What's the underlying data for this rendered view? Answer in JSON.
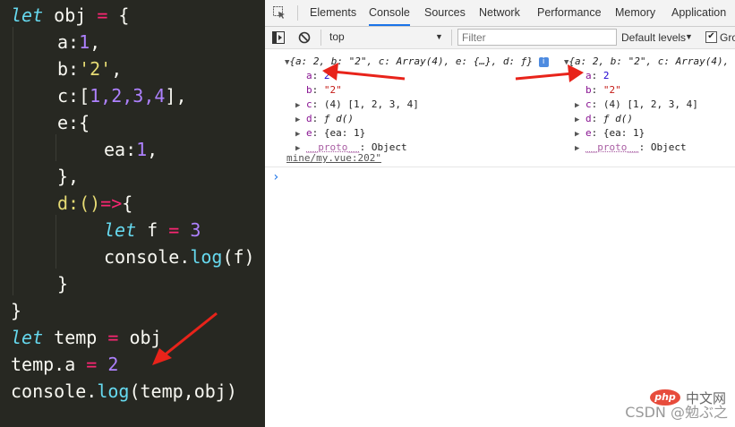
{
  "editor": {
    "lines": [
      {
        "kw": "let",
        "rest": " obj ",
        "op": "=",
        "tail": " {"
      },
      {
        "text": "a:",
        "num": "1",
        "tail": ","
      },
      {
        "text": "b:",
        "str": "'2'",
        "tail": ","
      },
      {
        "text": "c:[",
        "nums": "1,2,3,4",
        "tail": "],"
      },
      {
        "text": "e:{"
      },
      {
        "text": "ea:",
        "num": "1",
        "tail": ","
      },
      {
        "text": "},"
      },
      {
        "text": "d:()",
        "op": "=>",
        "tail": "{"
      },
      {
        "kw": "let",
        "rest": " f ",
        "op": "=",
        "num": " 3"
      },
      {
        "text": "console.",
        "fn": "log",
        "tail": "(f)"
      },
      {
        "text": "}"
      },
      {
        "text": "}"
      },
      {
        "kw": "let",
        "rest": " temp ",
        "op": "=",
        "tail": " obj"
      },
      {
        "text": "temp.a ",
        "op": "=",
        "num": " 2"
      },
      {
        "text": "console.",
        "fn": "log",
        "tail": "(temp,obj)"
      }
    ]
  },
  "devtools": {
    "tabs": [
      "Elements",
      "Console",
      "Sources",
      "Network",
      "Performance",
      "Memory",
      "Application"
    ],
    "active_tab": "Console",
    "context": "top",
    "filter_placeholder": "Filter",
    "levels": "Default levels",
    "group_label": "Gro",
    "group_checked": "✔",
    "log_left": {
      "summary": "{a: 2, b: \"2\", c: Array(4), e: {…}, d: ƒ}",
      "a": "2",
      "b": "\"2\"",
      "c": "(4) [1, 2, 3, 4]",
      "d": "ƒ d()",
      "e": "{ea: 1}",
      "proto": "__proto__",
      "proto_val": ": Object"
    },
    "log_right": {
      "summary": "{a: 2, b: \"2\", c: Array(4),",
      "a": "2",
      "b": "\"2\"",
      "c": "(4) [1, 2, 3, 4]",
      "d": "ƒ d()",
      "e": "{ea: 1}",
      "proto": "__proto__",
      "proto_val": ": Object"
    },
    "source_link": "mine/my.vue:202\"",
    "info_badge": "i"
  },
  "watermark": {
    "text": "CSDN @勉ぶ之",
    "php_logo": "php",
    "php_text": "中文网"
  },
  "colors": {
    "arrow": "#e8231a",
    "editor_bg": "#272822"
  }
}
